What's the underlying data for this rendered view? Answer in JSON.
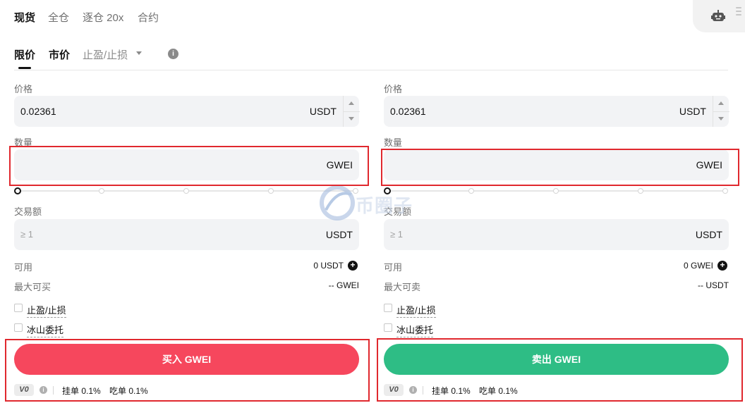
{
  "top_tabs": [
    "现货",
    "全仓",
    "逐仓 20x",
    "合约"
  ],
  "order_tabs": {
    "limit": "限价",
    "market": "市价",
    "tp_sl": "止盈/止损"
  },
  "watermark": "币圈子",
  "buy": {
    "price_label": "价格",
    "price_value": "0.02361",
    "price_unit": "USDT",
    "amount_label": "数量",
    "amount_unit": "GWEI",
    "slider_percent": 0,
    "total_label": "交易额",
    "total_placeholder": "≥ 1",
    "total_unit": "USDT",
    "available_label": "可用",
    "available_value": "0 USDT",
    "max_label": "最大可买",
    "max_value": "-- GWEI",
    "tp_sl_label": "止盈/止损",
    "iceberg_label": "冰山委托",
    "button_label": "买入 GWEI",
    "button_color": "#f6475d",
    "vip": "V0",
    "maker_fee": "挂单 0.1%",
    "taker_fee": "吃单 0.1%"
  },
  "sell": {
    "price_label": "价格",
    "price_value": "0.02361",
    "price_unit": "USDT",
    "amount_label": "数量",
    "amount_unit": "GWEI",
    "slider_percent": 0,
    "total_label": "交易额",
    "total_placeholder": "≥ 1",
    "total_unit": "USDT",
    "available_label": "可用",
    "available_value": "0 GWEI",
    "max_label": "最大可卖",
    "max_value": "-- USDT",
    "tp_sl_label": "止盈/止损",
    "iceberg_label": "冰山委托",
    "button_label": "卖出 GWEI",
    "button_color": "#2ebd85",
    "vip": "V0",
    "maker_fee": "挂单 0.1%",
    "taker_fee": "吃单 0.1%"
  },
  "colors": {
    "buy": "#f6475d",
    "sell": "#2ebd85",
    "highlight": "#e0282e"
  }
}
